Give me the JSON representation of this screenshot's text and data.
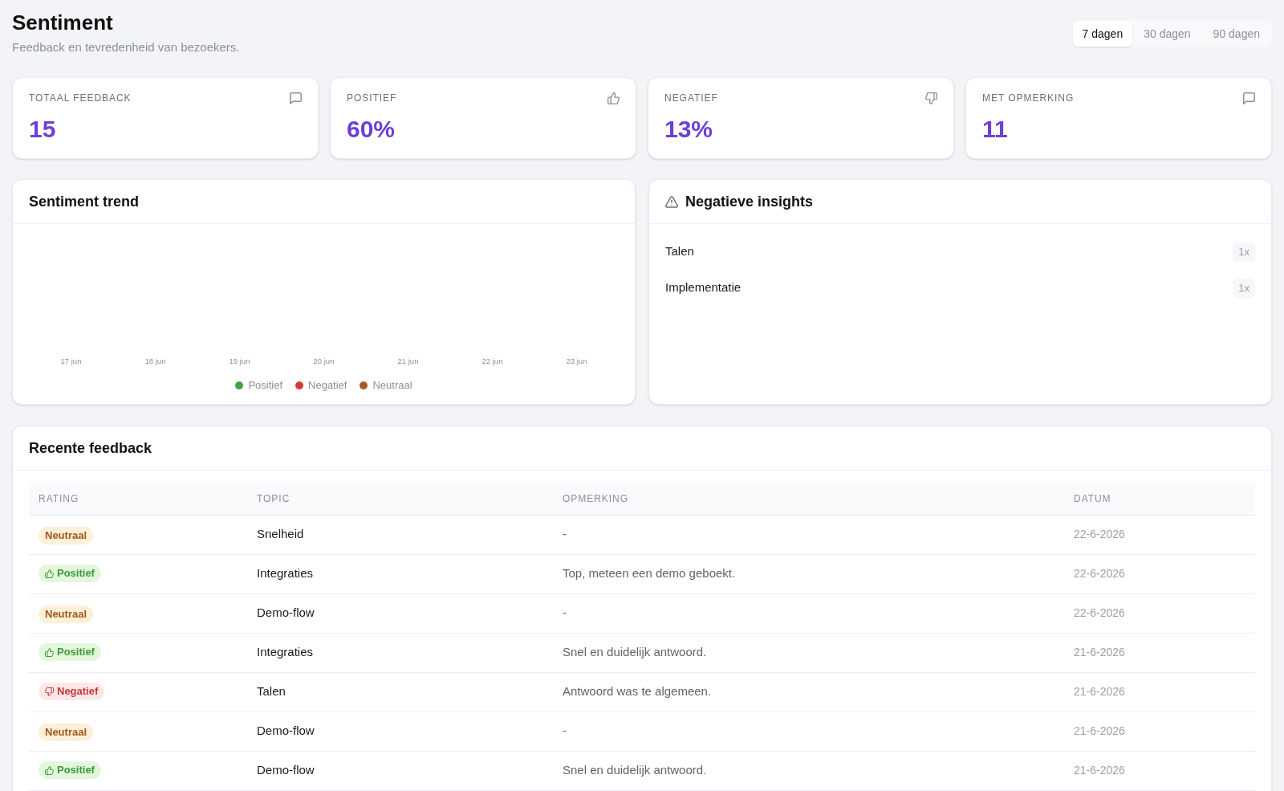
{
  "header": {
    "title": "Sentiment",
    "subtitle": "Feedback en tevredenheid van bezoekers."
  },
  "period_tabs": [
    {
      "label": "7 dagen",
      "selected": true
    },
    {
      "label": "30 dagen",
      "selected": false
    },
    {
      "label": "90 dagen",
      "selected": false
    }
  ],
  "stat_cards": [
    {
      "label": "TOTAAL FEEDBACK",
      "value": "15"
    },
    {
      "label": "POSITIEF",
      "value": "60%"
    },
    {
      "label": "NEGATIEF",
      "value": "13%"
    },
    {
      "label": "MET OPMERKING",
      "value": "11"
    }
  ],
  "trend_panel": {
    "title": "Sentiment trend",
    "axis_labels": [
      "17 jun",
      "18 jun",
      "19 jun",
      "20 jun",
      "21 jun",
      "22 jun",
      "23 jun"
    ],
    "legend": [
      {
        "label": "Positief",
        "color": "#43a047"
      },
      {
        "label": "Negatief",
        "color": "#d23c36"
      },
      {
        "label": "Neutraal",
        "color": "#ad5a1e"
      }
    ]
  },
  "insights_panel": {
    "title": "Negatieve insights",
    "items": [
      {
        "label": "Talen",
        "count": "1x"
      },
      {
        "label": "Implementatie",
        "count": "1x"
      }
    ]
  },
  "feedback_table": {
    "title": "Recente feedback",
    "columns": [
      "RATING",
      "TOPIC",
      "OPMERKING",
      "DATUM"
    ],
    "rows": [
      {
        "rating": {
          "kind": "neutral",
          "label": "Neutraal"
        },
        "topic": "Snelheid",
        "remark": "-",
        "date": "22-6-2026"
      },
      {
        "rating": {
          "kind": "positive",
          "label": "Positief"
        },
        "topic": "Integraties",
        "remark": "Top, meteen een demo geboekt.",
        "date": "22-6-2026"
      },
      {
        "rating": {
          "kind": "neutral",
          "label": "Neutraal"
        },
        "topic": "Demo-flow",
        "remark": "-",
        "date": "22-6-2026"
      },
      {
        "rating": {
          "kind": "positive",
          "label": "Positief"
        },
        "topic": "Integraties",
        "remark": "Snel en duidelijk antwoord.",
        "date": "21-6-2026"
      },
      {
        "rating": {
          "kind": "negative",
          "label": "Negatief"
        },
        "topic": "Talen",
        "remark": "Antwoord was te algemeen.",
        "date": "21-6-2026"
      },
      {
        "rating": {
          "kind": "neutral",
          "label": "Neutraal"
        },
        "topic": "Demo-flow",
        "remark": "-",
        "date": "21-6-2026"
      },
      {
        "rating": {
          "kind": "positive",
          "label": "Positief"
        },
        "topic": "Demo-flow",
        "remark": "Snel en duidelijk antwoord.",
        "date": "21-6-2026"
      }
    ]
  }
}
